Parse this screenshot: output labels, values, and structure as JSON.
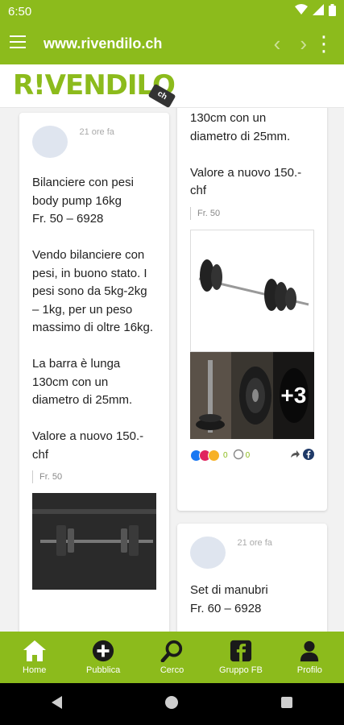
{
  "status": {
    "time": "6:50"
  },
  "browser": {
    "url": "www.rivendilo.ch",
    "back_glyph": "‹",
    "forward_glyph": "›",
    "more_glyph": "⋮"
  },
  "brand": {
    "logo_text": "R!VENDILO",
    "tag_text": "ch"
  },
  "feed": {
    "left_post": {
      "time_ago": "21 ore fa",
      "body": "Bilanciere con pesi body pump 16kg\nFr. 50 – 6928\n\nVendo bilanciere con pesi, in buono stato. I pesi sono da 5kg-2kg – 1kg, per un peso massimo di oltre 16kg.\n\nLa barra è lunga 130cm con un diametro di 25mm.\n\nValore a nuovo 150.- chf",
      "price": "Fr. 50"
    },
    "right_post": {
      "body": "130cm con un diametro di 25mm.\n\nValore a nuovo 150.- chf",
      "price": "Fr. 50",
      "extra_photos": "+3",
      "reaction_count": "0",
      "comment_count": "0"
    },
    "next_post": {
      "time_ago": "21 ore fa",
      "body": "Set di manubri\nFr. 60 – 6928"
    }
  },
  "bottom_nav": [
    {
      "label": "Home",
      "icon": "home-icon"
    },
    {
      "label": "Pubblica",
      "icon": "plus-circle-icon"
    },
    {
      "label": "Cerco",
      "icon": "search-icon"
    },
    {
      "label": "Gruppo FB",
      "icon": "facebook-icon"
    },
    {
      "label": "Profilo",
      "icon": "profile-icon"
    }
  ],
  "colors": {
    "brand_green": "#8cbb1c"
  }
}
